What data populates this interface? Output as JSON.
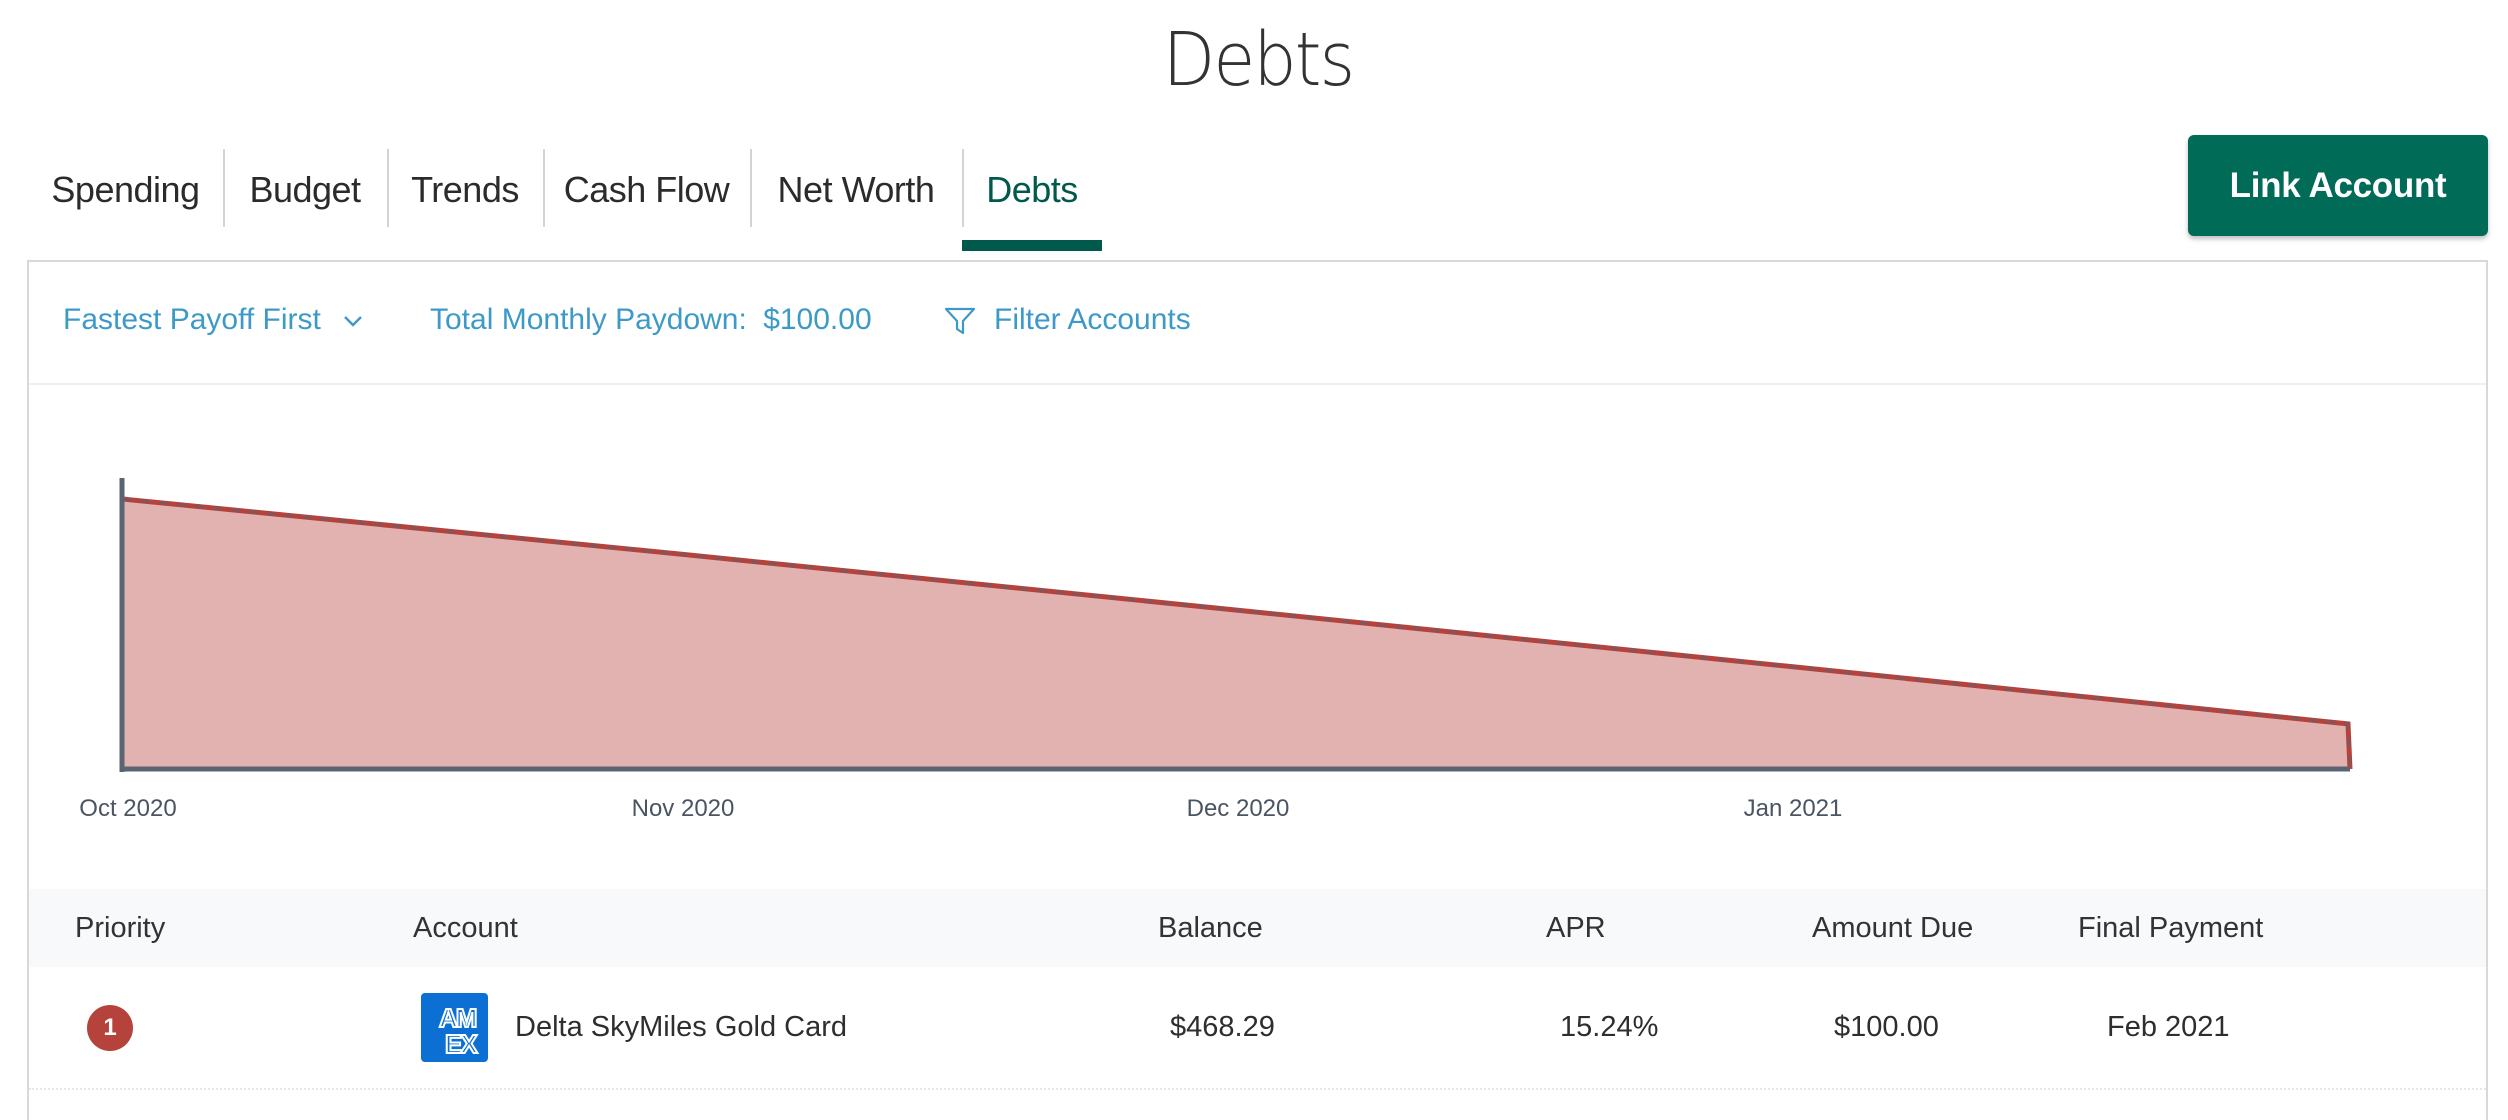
{
  "page": {
    "title": "Debts"
  },
  "tabs": [
    {
      "label": "Spending",
      "active": false
    },
    {
      "label": "Budget",
      "active": false
    },
    {
      "label": "Trends",
      "active": false
    },
    {
      "label": "Cash Flow",
      "active": false
    },
    {
      "label": "Net Worth",
      "active": false
    },
    {
      "label": "Debts",
      "active": true
    }
  ],
  "header": {
    "link_account_label": "Link Account"
  },
  "toolbar": {
    "strategy_label": "Fastest Payoff First",
    "strategy_icon": "chevron-down-icon",
    "paydown_label": "Total Monthly Paydown:",
    "paydown_value": "$100.00",
    "filter_icon": "filter-funnel-icon",
    "filter_label": "Filter Accounts"
  },
  "colors": {
    "brand_green": "#006b56",
    "tab_active": "#00594a",
    "link_blue": "#3d9ac8",
    "debt_red": "#b5433c",
    "area_fill": "#e1b2b0",
    "axis_gray": "#5a6472",
    "amex_blue": "#0b6fd4"
  },
  "chart_data": {
    "type": "area",
    "title": "",
    "xlabel": "",
    "ylabel": "",
    "x_tick_labels": [
      "Oct 2020",
      "Nov 2020",
      "Dec 2020",
      "Jan 2021"
    ],
    "x": [
      0,
      1,
      2,
      3,
      4,
      4.6
    ],
    "x_units": "months from Oct 2020",
    "series": [
      {
        "name": "Delta SkyMiles Gold Card balance",
        "values": [
          468.29,
          372.4,
          275.5,
          177.4,
          78.3,
          0
        ]
      }
    ],
    "xlim": [
      -0.01,
      4.0
    ],
    "ylim": [
      0,
      505
    ],
    "grid": false,
    "legend": "none"
  },
  "table": {
    "columns": [
      "Priority",
      "Account",
      "Balance",
      "APR",
      "Amount Due",
      "Final Payment"
    ],
    "rows": [
      {
        "priority": "1",
        "account_logo": "amex-logo-icon",
        "account_logo_text": [
          "AM",
          "EX"
        ],
        "account": "Delta SkyMiles Gold Card",
        "balance": "$468.29",
        "apr": "15.24%",
        "amount_due": "$100.00",
        "final_payment": "Feb 2021"
      }
    ]
  }
}
